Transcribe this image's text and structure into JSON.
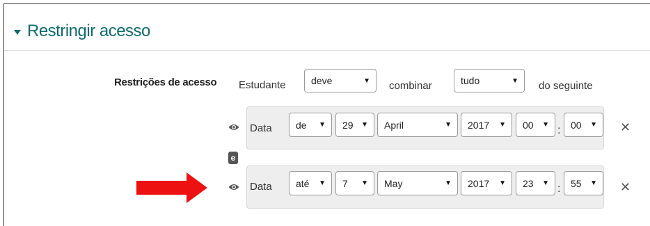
{
  "section": {
    "title": "Restringir acesso"
  },
  "restrictions": {
    "label": "Restrições de acesso",
    "prefix": "Estudante",
    "must_value": "deve",
    "middle": "combinar",
    "combine_value": "tudo",
    "suffix": "do seguinte"
  },
  "conditions": [
    {
      "label": "Data",
      "direction": "de",
      "day": "29",
      "month": "April",
      "year": "2017",
      "hour": "00",
      "minute": "00"
    },
    {
      "label": "Data",
      "direction": "até",
      "day": "7",
      "month": "May",
      "year": "2017",
      "hour": "23",
      "minute": "55"
    }
  ],
  "connector": "e",
  "colon": ":",
  "icons": {
    "section_toggle": "caret-down-icon",
    "visibility": "eye-icon",
    "delete": "close-icon",
    "select_arrow": "triangle-down-icon",
    "pointer": "arrow-right-icon"
  },
  "colors": {
    "heading": "#0f6b6b",
    "pointer_arrow": "#ee1111",
    "panel_bg": "#eeeeee",
    "badge_bg": "#555555"
  }
}
